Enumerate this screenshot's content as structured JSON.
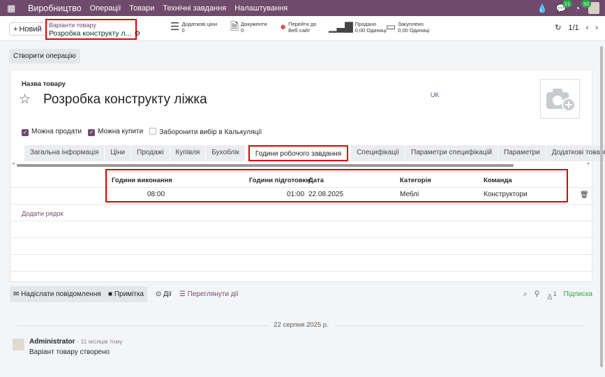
{
  "navbar": {
    "brand": "Виробництво",
    "menu": [
      "Операції",
      "Товари",
      "Технічні завдання",
      "Налаштування"
    ],
    "messages_count": "21",
    "activities_count": "33"
  },
  "control": {
    "new_label": "Новий",
    "breadcrumb_parent": "Варіанти товару",
    "breadcrumb_current": "Розробка конструкту л...",
    "smart_buttons": [
      {
        "title": "Додаткові ціни",
        "value": "0"
      },
      {
        "title": "Документи",
        "value": "0"
      },
      {
        "title": "Перейти до",
        "value": "Веб-сайт"
      },
      {
        "title": "Продано",
        "value": "0,00 Одиниці"
      },
      {
        "title": "Закуплено",
        "value": "0,00 Одиниці"
      }
    ],
    "pager": "1/1"
  },
  "create_operation": "Створити операцію",
  "form": {
    "name_label": "Назва товару",
    "product_name": "Розробка конструкту ліжка",
    "lang": "UK",
    "checks": [
      {
        "label": "Можна продати",
        "checked": true
      },
      {
        "label": "Можна купити",
        "checked": true
      },
      {
        "label": "Заборонити вибір в Калькуляції",
        "checked": false
      }
    ],
    "tabs": [
      "Загальна інформація",
      "Ціни",
      "Продажі",
      "Купівля",
      "Бухоблік",
      "Години робочого завдання",
      "Специфікації",
      "Параметри специфікацій",
      "Параметри",
      "Додаткові товари"
    ],
    "active_tab": "Години робочого завдання"
  },
  "grid": {
    "headers": {
      "hours_exec": "Години виконання",
      "hours_prep": "Години підготовки",
      "date": "Дата",
      "category": "Категорія",
      "team": "Команда"
    },
    "row": {
      "hours_exec": "08:00",
      "hours_prep": "01:00",
      "date": "22.08.2025",
      "category": "Меблі",
      "team": "Конструктори"
    },
    "add_row": "Додати рядок"
  },
  "chatter": {
    "send_message": "Надіслати повідомлення",
    "note": "Примітка",
    "activities": "Дії",
    "view_activities": "Переглянути дії",
    "followers_count": "1",
    "follow": "Підписка",
    "date_separator": "22 серпня 2025 р.",
    "author": "Administrator",
    "time_ago": "- 11 місяців тому",
    "message": "Варіант товару створено"
  }
}
